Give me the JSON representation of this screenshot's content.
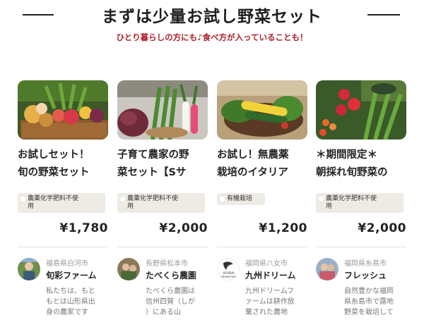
{
  "header": {
    "title": "まずは少量お試し野菜セット",
    "subtitle": "ひとり暮らしの方にも♪食べ方が入っていることも！"
  },
  "cards": [
    {
      "name_line1": "お試しセット！",
      "name_line2": "旬の野菜セット",
      "tag_line1": "農薬化学肥料不使",
      "tag_line2": "用",
      "price": "¥1,780",
      "location": "福島県白河市",
      "farm": "旬彩ファーム",
      "desc_lines": [
        "私たちは、もと",
        "もとは山形県出",
        "身の農家です"
      ]
    },
    {
      "name_line1": "子育て農家の野",
      "name_line2": "菜セット【Sサ",
      "tag_line1": "農薬化学肥料不使",
      "tag_line2": "用",
      "price": "¥2,000",
      "location": "長野県松本市",
      "farm": "たべくら農園",
      "desc_lines": [
        "たべくら農園は",
        "信州四賀（しが",
        "）にある山"
      ]
    },
    {
      "name_line1": "お試し！無農薬",
      "name_line2": "栽培のイタリア",
      "tag_line1": "有機栽培",
      "tag_line2": "",
      "price": "¥1,200",
      "location": "福岡県八女市",
      "farm": "九州ドリーム",
      "avatar_logo_line1": "KYUSHU",
      "avatar_logo_line2": "DREAM FARM",
      "desc_lines": [
        "九州ドリームフ",
        "ァームは耕作放",
        "棄された農地"
      ]
    },
    {
      "name_line1": "＊期間限定＊",
      "name_line2": "朝採れ旬野菜の",
      "tag_line1": "農薬化学肥料不使",
      "tag_line2": "用",
      "price": "¥2,000",
      "location": "福岡県糸島市",
      "farm": "フレッシュ",
      "desc_lines": [
        "自然豊かな福岡",
        "県糸島市で露地",
        "野菜を栽培して"
      ]
    }
  ],
  "colors": {
    "subtitle": "#b0202a",
    "tag_bg": "#eeebe4",
    "accent": "#1f1f1f"
  }
}
